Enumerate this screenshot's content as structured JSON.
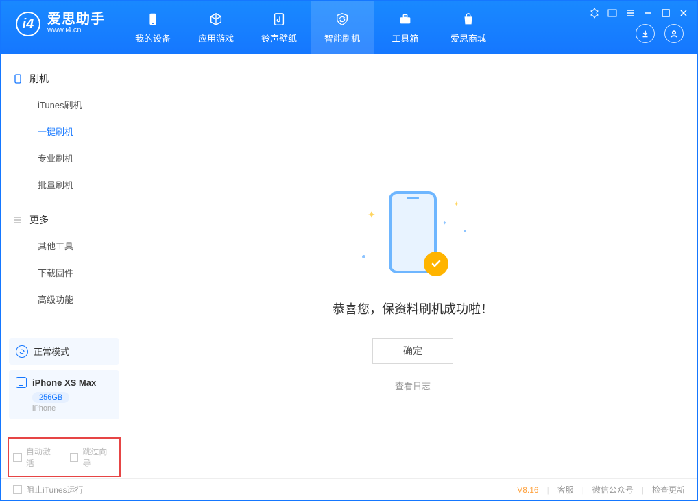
{
  "app": {
    "name_cn": "爱思助手",
    "url": "www.i4.cn"
  },
  "nav": {
    "items": [
      {
        "label": "我的设备"
      },
      {
        "label": "应用游戏"
      },
      {
        "label": "铃声壁纸"
      },
      {
        "label": "智能刷机"
      },
      {
        "label": "工具箱"
      },
      {
        "label": "爱思商城"
      }
    ]
  },
  "sidebar": {
    "section1_title": "刷机",
    "section1_items": [
      {
        "label": "iTunes刷机"
      },
      {
        "label": "一键刷机"
      },
      {
        "label": "专业刷机"
      },
      {
        "label": "批量刷机"
      }
    ],
    "section2_title": "更多",
    "section2_items": [
      {
        "label": "其他工具"
      },
      {
        "label": "下载固件"
      },
      {
        "label": "高级功能"
      }
    ],
    "mode_label": "正常模式",
    "device_name": "iPhone XS Max",
    "device_capacity": "256GB",
    "device_type": "iPhone",
    "checks": {
      "auto_activate": "自动激活",
      "skip_guide": "跳过向导"
    }
  },
  "main": {
    "success_text": "恭喜您，保资料刷机成功啦！",
    "ok_button": "确定",
    "view_log": "查看日志"
  },
  "footer": {
    "block_itunes": "阻止iTunes运行",
    "version": "V8.16",
    "support": "客服",
    "wechat": "微信公众号",
    "update": "检查更新"
  }
}
